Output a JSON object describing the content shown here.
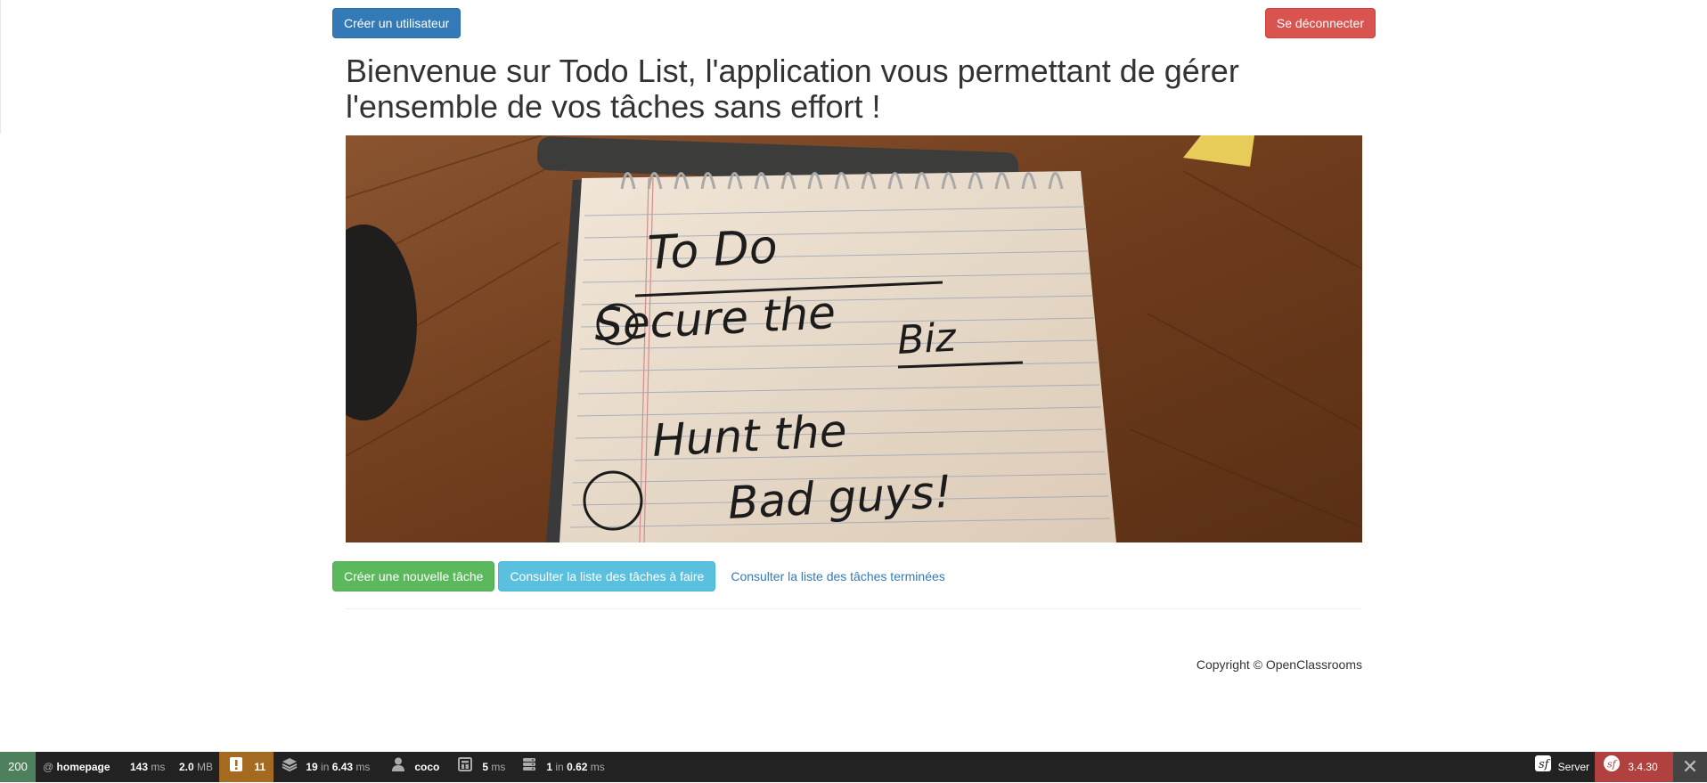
{
  "header": {
    "create_user_label": "Créer un utilisateur",
    "logout_label": "Se déconnecter"
  },
  "main": {
    "title": "Bienvenue sur Todo List, l'application vous permettant de gérer l'ensemble de vos tâches sans effort !",
    "hero_image": {
      "heading": "To Do",
      "line1": "Secure the",
      "line1b": "Biz",
      "line2": "Hunt the",
      "line2b": "Bad guys!"
    },
    "actions": {
      "new_task_label": "Créer une nouvelle tâche",
      "todo_list_label": "Consulter la liste des tâches à faire",
      "done_list_label": "Consulter la liste des tâches terminées"
    }
  },
  "footer": {
    "copyright": "Copyright © OpenClassrooms"
  },
  "toolbar": {
    "status_code": "200",
    "route_prefix": "@",
    "route": "homepage",
    "time_value": "143",
    "time_unit": "ms",
    "memory_value": "2.0",
    "memory_unit": "MB",
    "warnings": "11",
    "cache_count": "19",
    "cache_in": "in",
    "cache_time": "6.43",
    "cache_unit": "ms",
    "user": "coco",
    "twig_time": "5",
    "twig_unit": "ms",
    "db_count": "1",
    "db_in": "in",
    "db_time": "0.62",
    "db_unit": "ms",
    "server_label": "Server",
    "symfony_version": "3.4.30",
    "colors": {
      "status_ok": "#4f805d",
      "warning": "#a46a1f",
      "version": "#b0413e",
      "bar": "#222222"
    }
  }
}
